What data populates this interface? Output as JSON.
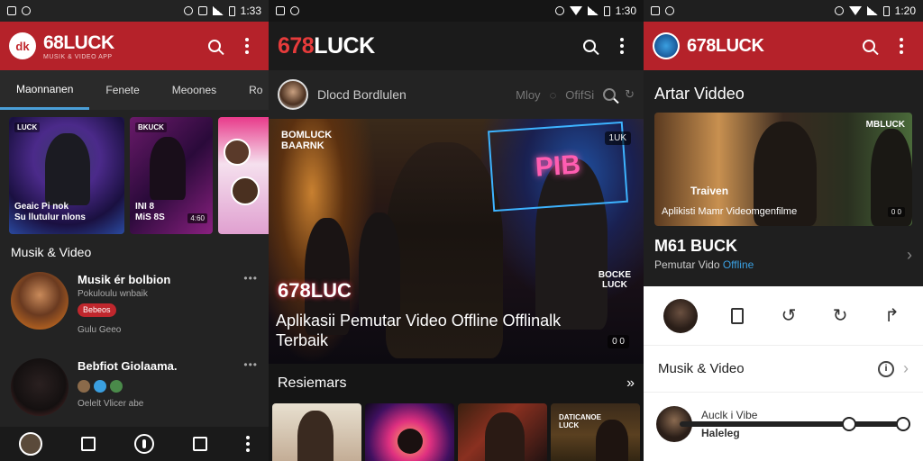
{
  "colors": {
    "brand_red": "#b5222a",
    "accent_blue": "#3a9fe0",
    "pill_red": "#c0272d"
  },
  "p1": {
    "status": {
      "time": "1:33"
    },
    "brand": {
      "title": "68LUCK",
      "subtitle": "MUSIK & VIDEO APP",
      "logo_text": "dk"
    },
    "tabs": [
      {
        "label": "Maonnanen"
      },
      {
        "label": "Fenete"
      },
      {
        "label": "Meoones"
      },
      {
        "label": "Ro"
      }
    ],
    "thumbs": [
      {
        "tag": "LUCK",
        "caption": "Geaic Pi nok\nSu llutulur nlons",
        "duration": ""
      },
      {
        "tag": "BKUCK",
        "caption": "INI 8\nMiS 8S",
        "duration": "4:60"
      },
      {
        "tag": "",
        "caption": "",
        "duration": ""
      }
    ],
    "section_title": "Musik & Video",
    "rows": [
      {
        "title": "Musik ér bolbion",
        "sub": "Pokuloulu wnbaik",
        "pill": "Bebeos",
        "extra": "Gulu Geeo"
      },
      {
        "title": "Bebfiot Giolaama.",
        "sub": "",
        "pill": "",
        "extra": "Oelelt Vlicer abe"
      }
    ]
  },
  "p2": {
    "status": {
      "time": "1:30"
    },
    "title_num": "678",
    "title_word": "LUCK",
    "subbar": {
      "name": "Dlocd Bordlulen",
      "ghost1": "Mloy",
      "ghost2": "OfifSi"
    },
    "hero": {
      "brand_tl": "BOMLUCK\nBAARNK",
      "neon": "PIB",
      "hd_tag": "1UK",
      "logo": "678LUC",
      "side_tag": "BOCKE\nLUCK",
      "headline": "Aplikasii Pemutar Video Offline Offlinalk Terbaik",
      "duration": "0 0"
    },
    "section_title": "Resiemars",
    "section_arrow": "»",
    "strip": [
      {
        "caption": ""
      },
      {
        "caption": ""
      },
      {
        "caption": ""
      },
      {
        "caption": "DATICANOE\nLUCK"
      }
    ]
  },
  "p3": {
    "status": {
      "time": "1:20"
    },
    "title": "678LUCK",
    "section_title": "Artar Viddeo",
    "hero": {
      "brand": "MBLUCK",
      "cap1": "Traiven",
      "cap2": "Aplikisti Mamr Videomgenfilme",
      "duration": "0 0"
    },
    "info": {
      "title": "M61 BUCK",
      "sub_prefix": "Pemutar Vido ",
      "sub_link": "Offline"
    },
    "list_label": "Musik & Video",
    "list_info_glyph": "i",
    "mini": {
      "title": "Auclk i Vibe",
      "sub": "Haleleg"
    }
  }
}
